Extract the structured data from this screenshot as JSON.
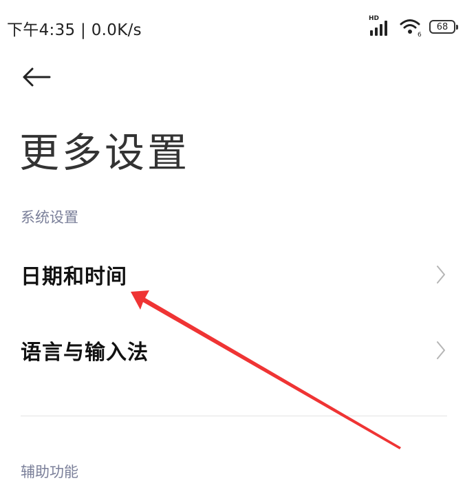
{
  "status_bar": {
    "time_speed": "下午4:35 | 0.0K/s",
    "network_badge": "HD",
    "wifi_slot": "6",
    "battery_level": "68"
  },
  "header": {
    "back_icon": "back-arrow-icon",
    "title": "更多设置"
  },
  "sections": [
    {
      "label": "系统设置",
      "items": [
        {
          "label": "日期和时间",
          "icon": "chevron-right-icon"
        },
        {
          "label": "语言与输入法",
          "icon": "chevron-right-icon"
        }
      ]
    },
    {
      "label": "辅助功能"
    }
  ],
  "colors": {
    "annotation_arrow": "#ef3434",
    "section_label": "#7a7f99"
  }
}
